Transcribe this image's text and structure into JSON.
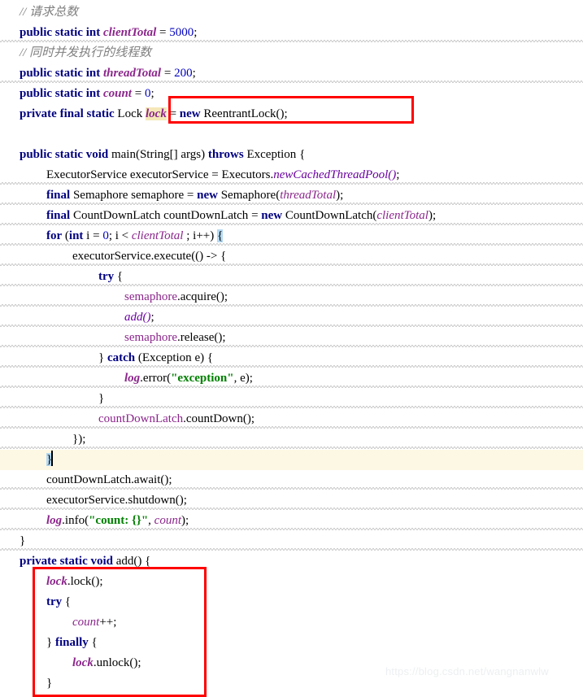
{
  "editor": {
    "language": "java",
    "colors": {
      "background": "#ffffff",
      "keyword": "#000080",
      "number": "#0000c0",
      "string": "#008000",
      "comment": "#808080",
      "field": "#8b268b",
      "occurrence_highlight": "#f5e8b8",
      "brace_match_highlight": "#b4d9f2",
      "current_line": "#fdf8e3",
      "annotation_box": "#ff0000",
      "squiggle": "#c9c9c9"
    },
    "lines": [
      {
        "n": 1,
        "text": "// 请求总数"
      },
      {
        "n": 2,
        "text": "public static int clientTotal = 5000;"
      },
      {
        "n": 3,
        "text": "// 同时并发执行的线程数"
      },
      {
        "n": 4,
        "text": "public static int threadTotal = 200;"
      },
      {
        "n": 5,
        "text": "public static int count = 0;"
      },
      {
        "n": 6,
        "text": "private final static Lock lock = new ReentrantLock();"
      },
      {
        "n": 7,
        "text": ""
      },
      {
        "n": 8,
        "text": "public static void main(String[] args) throws Exception {"
      },
      {
        "n": 9,
        "text": "    ExecutorService executorService = Executors.newCachedThreadPool();"
      },
      {
        "n": 10,
        "text": "    final Semaphore semaphore = new Semaphore(threadTotal);"
      },
      {
        "n": 11,
        "text": "    final CountDownLatch countDownLatch = new CountDownLatch(clientTotal);"
      },
      {
        "n": 12,
        "text": "    for (int i = 0; i < clientTotal ; i++) {"
      },
      {
        "n": 13,
        "text": "        executorService.execute(() -> {"
      },
      {
        "n": 14,
        "text": "            try {"
      },
      {
        "n": 15,
        "text": "                semaphore.acquire();"
      },
      {
        "n": 16,
        "text": "                add();"
      },
      {
        "n": 17,
        "text": "                semaphore.release();"
      },
      {
        "n": 18,
        "text": "            } catch (Exception e) {"
      },
      {
        "n": 19,
        "text": "                log.error(\"exception\", e);"
      },
      {
        "n": 20,
        "text": "            }"
      },
      {
        "n": 21,
        "text": "            countDownLatch.countDown();"
      },
      {
        "n": 22,
        "text": "        });"
      },
      {
        "n": 23,
        "text": "    }"
      },
      {
        "n": 24,
        "text": "    countDownLatch.await();"
      },
      {
        "n": 25,
        "text": "    executorService.shutdown();"
      },
      {
        "n": 26,
        "text": "    log.info(\"count: {}\", count);"
      },
      {
        "n": 27,
        "text": "}"
      },
      {
        "n": 28,
        "text": "private static void add() {"
      },
      {
        "n": 29,
        "text": "    lock.lock();"
      },
      {
        "n": 30,
        "text": "    try {"
      },
      {
        "n": 31,
        "text": "        count++;"
      },
      {
        "n": 32,
        "text": "    } finally {"
      },
      {
        "n": 33,
        "text": "        lock.unlock();"
      },
      {
        "n": 34,
        "text": "    }"
      }
    ],
    "tokens": {
      "comment_request_total": "// 请求总数",
      "comment_thread_total": "// 同时并发执行的线程数",
      "kw_public": "public",
      "kw_private": "private",
      "kw_static": "static",
      "kw_final": "final",
      "kw_int": "int",
      "kw_void": "void",
      "kw_new": "new",
      "kw_for": "for",
      "kw_try": "try",
      "kw_catch": "catch",
      "kw_finally": "finally",
      "kw_throws": "throws",
      "type_lock": "Lock",
      "type_reentrantlock": "ReentrantLock()",
      "type_executorservice": "ExecutorService",
      "type_executors": "Executors",
      "type_semaphore": "Semaphore",
      "type_countdownlatch": "CountDownLatch",
      "type_string_args": "main(String[] args)",
      "type_exception": "Exception",
      "field_clienttotal": "clientTotal",
      "field_threadtotal": "threadTotal",
      "field_count": "count",
      "field_lock": "lock",
      "field_log": "log",
      "num_5000": "5000",
      "num_200": "200",
      "num_0": "0",
      "str_exception": "\"exception\"",
      "str_count_braces": "\"count: {}\"",
      "var_executorservice": "executorService",
      "var_semaphore": "semaphore",
      "var_countdownlatch": "countDownLatch",
      "method_newcachedthreadpool": "newCachedThreadPool()",
      "method_execute": "execute",
      "method_acquire": "acquire()",
      "method_release": "release()",
      "method_add": "add()",
      "method_error": "error",
      "method_info": "info",
      "method_countdown": "countDown()",
      "method_await": "await()",
      "method_shutdown": "shutdown()",
      "method_lock": "lock()",
      "method_unlock": "unlock()"
    }
  },
  "annotations": {
    "box_1_label": "lock-declaration-highlight",
    "box_2_label": "lock-try-finally-highlight"
  },
  "watermark": {
    "text": "https://blog.csdn.net/wangnanwlw"
  }
}
